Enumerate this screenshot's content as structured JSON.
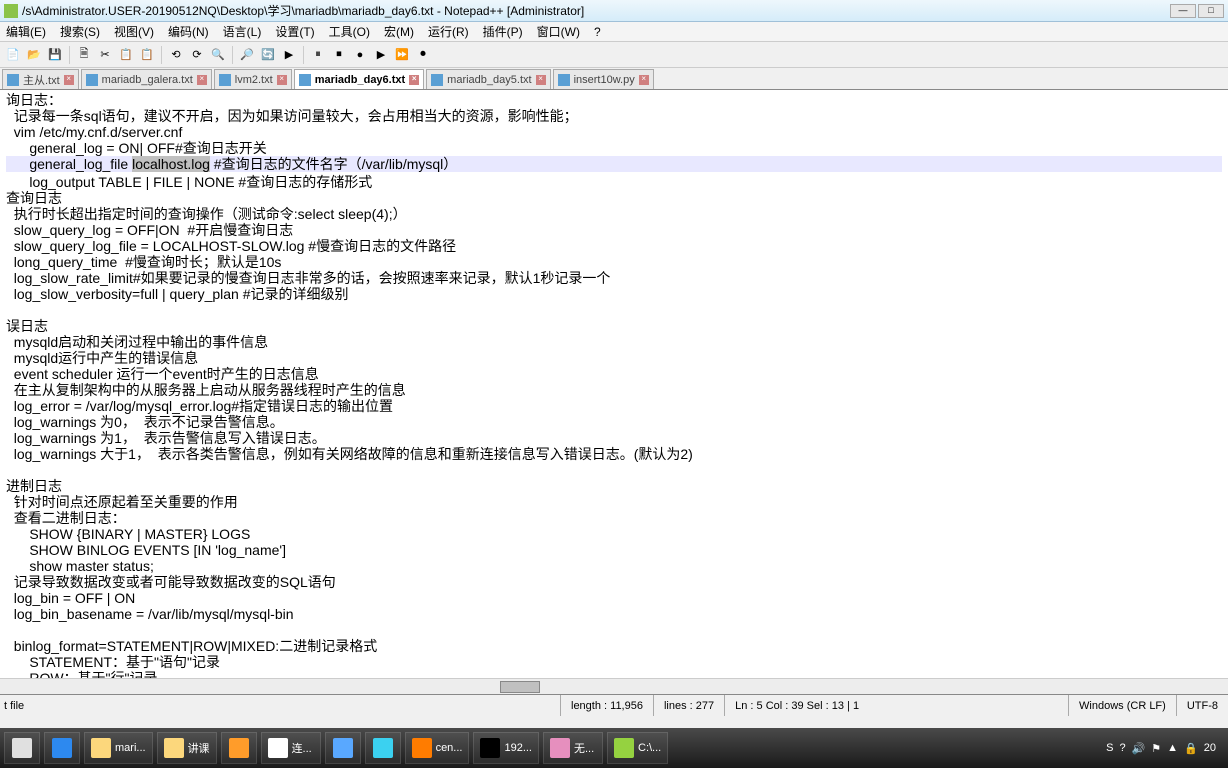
{
  "title": "/s\\Administrator.USER-20190512NQ\\Desktop\\学习\\mariadb\\mariadb_day6.txt - Notepad++ [Administrator]",
  "menu": {
    "items": [
      "编辑(E)",
      "搜索(S)",
      "视图(V)",
      "编码(N)",
      "语言(L)",
      "设置(T)",
      "工具(O)",
      "宏(M)",
      "运行(R)",
      "插件(P)",
      "窗口(W)",
      "?"
    ]
  },
  "toolbar_icons": [
    "📄",
    "📂",
    "💾",
    "🗎",
    "✂",
    "📋",
    "📋",
    "⟲",
    "⟳",
    "🔍",
    "🔎",
    "🔄",
    "▶",
    "⏸",
    "⏹",
    "●",
    "▶",
    "⏩",
    "⏺"
  ],
  "tabs": [
    {
      "label": "主从.txt",
      "active": false
    },
    {
      "label": "mariadb_galera.txt",
      "active": false
    },
    {
      "label": "lvm2.txt",
      "active": false
    },
    {
      "label": "mariadb_day6.txt",
      "active": true
    },
    {
      "label": "mariadb_day5.txt",
      "active": false
    },
    {
      "label": "insert10w.py",
      "active": false
    }
  ],
  "editor": {
    "lines": [
      "询日志：",
      "  记录每一条sql语句，建议不开启，因为如果访问量较大，会占用相当大的资源，影响性能；",
      "  vim /etc/my.cnf.d/server.cnf",
      "      general_log = ON| OFF#查询日志开关",
      "      general_log_file localhost.log #查询日志的文件名字（/var/lib/mysql）",
      "      log_output TABLE | FILE | NONE #查询日志的存储形式",
      "查询日志",
      "  执行时长超出指定时间的查询操作（测试命令:select sleep(4);）",
      "  slow_query_log = OFF|ON  #开启慢查询日志",
      "  slow_query_log_file = LOCALHOST-SLOW.log #慢查询日志的文件路径",
      "  long_query_time  #慢查询时长；默认是10s",
      "  log_slow_rate_limit#如果要记录的慢查询日志非常多的话，会按照速率来记录，默认1秒记录一个",
      "  log_slow_verbosity=full | query_plan #记录的详细级别",
      "",
      "误日志",
      "  mysqld启动和关闭过程中输出的事件信息",
      "  mysqld运行中产生的错误信息",
      "  event scheduler 运行一个event时产生的日志信息",
      "  在主从复制架构中的从服务器上启动从服务器线程时产生的信息",
      "  log_error = /var/log/mysql_error.log#指定错误日志的输出位置",
      "  log_warnings 为0，  表示不记录告警信息。",
      "  log_warnings 为1，  表示告警信息写入错误日志。",
      "  log_warnings 大于1，  表示各类告警信息，例如有关网络故障的信息和重新连接信息写入错误日志。(默认为2)",
      "",
      "进制日志",
      "  针对时间点还原起着至关重要的作用",
      "  查看二进制日志：",
      "      SHOW {BINARY | MASTER} LOGS",
      "      SHOW BINLOG EVENTS [IN 'log_name']",
      "      show master status;",
      "  记录导致数据改变或者可能导致数据改变的SQL语句",
      "  log_bin = OFF | ON",
      "  log_bin_basename = /var/lib/mysql/mysql-bin",
      "",
      "  binlog_format=STATEMENT|ROW|MIXED:二进制记录格式",
      "      STATEMENT：基于\"语句\"记录",
      "      ROW：基于\"行\"记录"
    ],
    "current_line_index": 4,
    "selection_text": "localhost.log"
  },
  "status": {
    "left": "t file",
    "length": "length : 11,956",
    "lines": "lines : 277",
    "pos": "Ln : 5   Col : 39   Sel : 13 | 1",
    "eol": "Windows (CR LF)",
    "enc": "UTF-8"
  },
  "taskbar": {
    "items": [
      {
        "label": "",
        "color": "#e0e0e0"
      },
      {
        "label": "",
        "color": "#2d89ef"
      },
      {
        "label": "mari...",
        "color": "#fcd77c"
      },
      {
        "label": "讲课",
        "color": "#fcd77c"
      },
      {
        "label": "",
        "color": "#ff9c2a"
      },
      {
        "label": "连...",
        "color": "#ffffff"
      },
      {
        "label": "",
        "color": "#59a8ff"
      },
      {
        "label": "",
        "color": "#3bd1f0"
      },
      {
        "label": "cen...",
        "color": "#ff7c00"
      },
      {
        "label": "192...",
        "color": "#000000"
      },
      {
        "label": "无...",
        "color": "#e68fbe"
      },
      {
        "label": "C:\\...",
        "color": "#95d240"
      }
    ],
    "tray": [
      "S",
      "?",
      "🔊",
      "⚑",
      "▲",
      "🔒",
      "20"
    ]
  }
}
